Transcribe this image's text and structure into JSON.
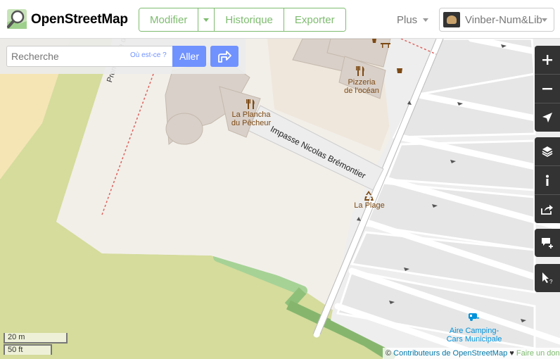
{
  "header": {
    "brand": "OpenStreetMap",
    "edit_label": "Modifier",
    "history_label": "Historique",
    "export_label": "Exporter",
    "more_label": "Plus",
    "user_name": "Vinber-Num&Lib"
  },
  "search": {
    "placeholder": "Recherche",
    "where_label": "Où est-ce ?",
    "go_label": "Aller"
  },
  "map": {
    "labels": {
      "promenade": "Promenade de",
      "pizzeria_line1": "Pizzeria",
      "pizzeria_line2": "de l'océan",
      "plancha_line1": "La Plancha",
      "plancha_line2": "du Pêcheur",
      "impasse": "Impasse Nicolas Brémontier",
      "la_plage": "La Plage",
      "camping_line1": "Aire Camping-",
      "camping_line2": "Cars Municipale"
    },
    "edge_letter": "P"
  },
  "scale": {
    "metric": "20 m",
    "imperial": "50 ft"
  },
  "attribution": {
    "copyright": "©",
    "contributors": "Contributeurs de OpenStreetMap",
    "heart": "♥",
    "donate": "Faire un don"
  },
  "colors": {
    "accent_green": "#7ebc6f",
    "accent_blue": "#7092ff",
    "poi_brown": "#7d4a14",
    "camping_blue": "#0092da"
  }
}
